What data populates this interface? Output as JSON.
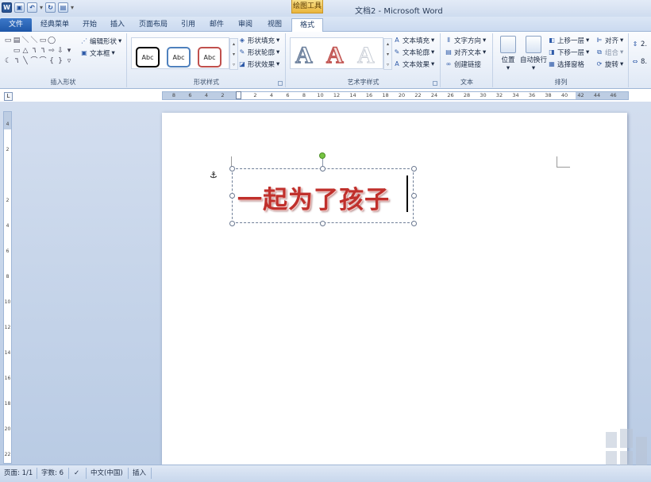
{
  "window": {
    "title": "文档2 - Microsoft Word",
    "context_header": "绘图工具"
  },
  "tabs": [
    "文件",
    "经典菜单",
    "开始",
    "插入",
    "页面布局",
    "引用",
    "邮件",
    "审阅",
    "视图",
    "格式"
  ],
  "active_tab": "格式",
  "ribbon": {
    "insert_shapes": {
      "label": "插入形状",
      "edit_shape": "编辑形状",
      "text_box": "文本框",
      "shape_glyphs": [
        "▭",
        "▤",
        "＼",
        "＼",
        "▭",
        "◯",
        "",
        "",
        " ",
        "▭",
        "△",
        "٦",
        "٦",
        "⇨",
        "⇩",
        "▾",
        "☾",
        "٦",
        "╲",
        "⌒",
        "⌒",
        "{",
        "}",
        "▿"
      ]
    },
    "shape_styles": {
      "label": "形状样式",
      "swatches": [
        "Abc",
        "Abc",
        "Abc"
      ],
      "swatch_colors": [
        "#000000",
        "#4f81bd",
        "#c0504d"
      ],
      "fill": "形状填充",
      "outline": "形状轮廓",
      "effects": "形状效果"
    },
    "wordart_styles": {
      "label": "艺术字样式",
      "samples": [
        "A",
        "A",
        "A"
      ],
      "text_fill": "文本填充",
      "text_outline": "文本轮廓",
      "text_effects": "文本效果"
    },
    "text": {
      "label": "文本",
      "direction": "文字方向",
      "align": "对齐文本",
      "link": "创建链接"
    },
    "arrange": {
      "label": "排列",
      "position": "位置",
      "wrap": "自动换行",
      "bring_forward": "上移一层",
      "send_backward": "下移一层",
      "selection_pane": "选择窗格",
      "align": "对齐",
      "group": "组合",
      "rotate": "旋转"
    },
    "size": {
      "height_value": "2.",
      "width_value": "8."
    }
  },
  "ruler": {
    "h_labels": [
      "8",
      "6",
      "4",
      "2",
      "",
      "2",
      "4",
      "6",
      "8",
      "10",
      "12",
      "14",
      "16",
      "18",
      "20",
      "22",
      "24",
      "26",
      "28",
      "30",
      "32",
      "34",
      "36",
      "38",
      "40",
      "42",
      "44",
      "46"
    ],
    "v_labels": [
      "4",
      "2",
      "",
      "2",
      "4",
      "6",
      "8",
      "10",
      "12",
      "14",
      "16",
      "18",
      "20",
      "22"
    ]
  },
  "document": {
    "wordart_text": "一起为了孩子"
  },
  "status": {
    "page": "页面: 1/1",
    "words": "字数: 6",
    "language": "中文(中国)",
    "mode": "插入"
  }
}
